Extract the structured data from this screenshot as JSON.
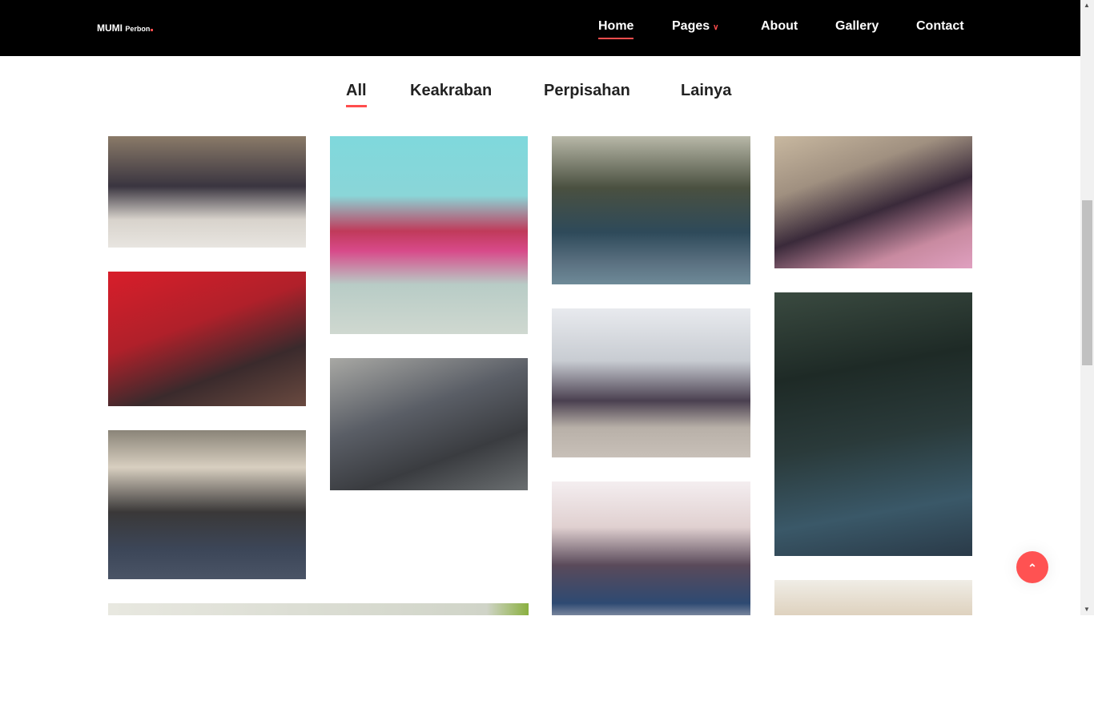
{
  "brand": {
    "name": "MUMI",
    "sub": "Perbon"
  },
  "nav": {
    "items": [
      "Home",
      "Pages",
      "About",
      "Gallery",
      "Contact"
    ],
    "active": "Home"
  },
  "filters": {
    "items": [
      "All",
      "Keakraban",
      "Perpisahan",
      "Lainya"
    ],
    "active": "All"
  },
  "colors": {
    "accent": "#ff4d4d",
    "header": "#000000"
  },
  "scroll_top_icon": "chevron-up-icon"
}
